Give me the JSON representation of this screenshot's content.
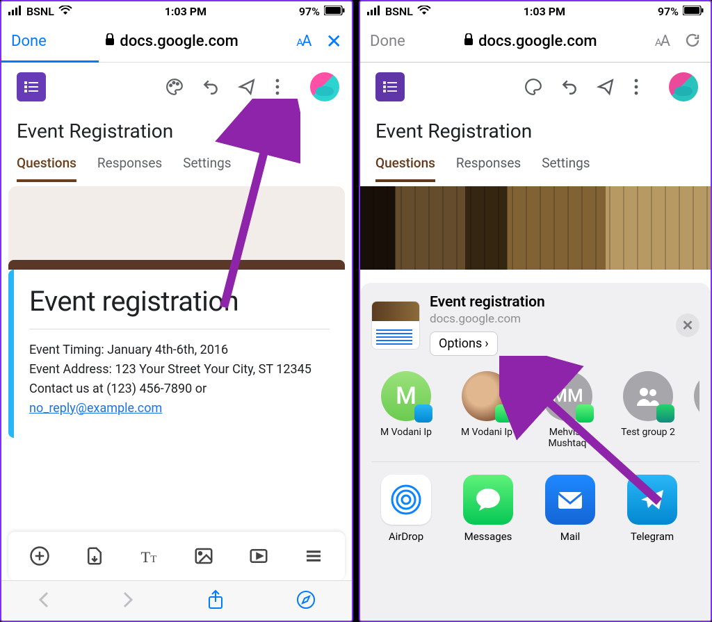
{
  "status": {
    "carrier": "BSNL",
    "time": "1:03 PM",
    "battery": "97%"
  },
  "safari": {
    "done": "Done",
    "url": "docs.google.com",
    "aa": "AA"
  },
  "form": {
    "title": "Event Registration"
  },
  "tabs": {
    "questions": "Questions",
    "responses": "Responses",
    "settings": "Settings"
  },
  "card": {
    "heading": "Event registration",
    "line1": "Event Timing: January 4th-6th, 2016",
    "line2": "Event Address: 123 Your Street Your City, ST 12345",
    "line3_pre": "Contact us at (123) 456-7890 or ",
    "email": "no_reply@example.com"
  },
  "share": {
    "title": "Event registration",
    "domain": "docs.google.com",
    "options": "Options",
    "contacts": [
      "M Vodani Ip",
      "M Vodani Ip",
      "Mehvish Mushtaq",
      "Test group 2"
    ],
    "mm": "MM",
    "letter": "M",
    "apps": {
      "airdrop": "AirDrop",
      "messages": "Messages",
      "mail": "Mail",
      "telegram": "Telegram"
    }
  }
}
